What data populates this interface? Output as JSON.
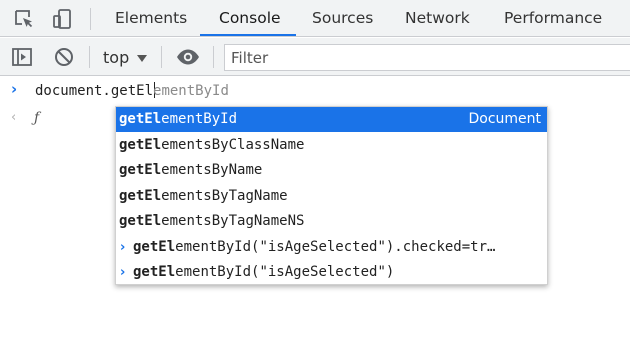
{
  "tabs": [
    {
      "label": "Elements"
    },
    {
      "label": "Console"
    },
    {
      "label": "Sources"
    },
    {
      "label": "Network"
    },
    {
      "label": "Performance"
    }
  ],
  "active_tab": "Console",
  "toolbar": {
    "context": "top",
    "filter_placeholder": "Filter"
  },
  "console": {
    "input_typed": "document.getEl",
    "input_ghost": "ementById",
    "result_symbol": "ƒ"
  },
  "autocomplete": {
    "match_prefix": "getEl",
    "items": [
      {
        "rest": "ementById",
        "type": "Document",
        "selected": true
      },
      {
        "rest": "ementsByClassName"
      },
      {
        "rest": "ementsByName"
      },
      {
        "rest": "ementsByTagName"
      },
      {
        "rest": "ementsByTagNameNS"
      },
      {
        "rest": "ementById(\"isAgeSelected\").checked=tr…",
        "history": true
      },
      {
        "rest": "ementById(\"isAgeSelected\")",
        "history": true
      }
    ]
  },
  "colors": {
    "accent": "#1a73e8",
    "toolbar_bg": "#f1f3f4",
    "border": "#cbcdd1"
  }
}
